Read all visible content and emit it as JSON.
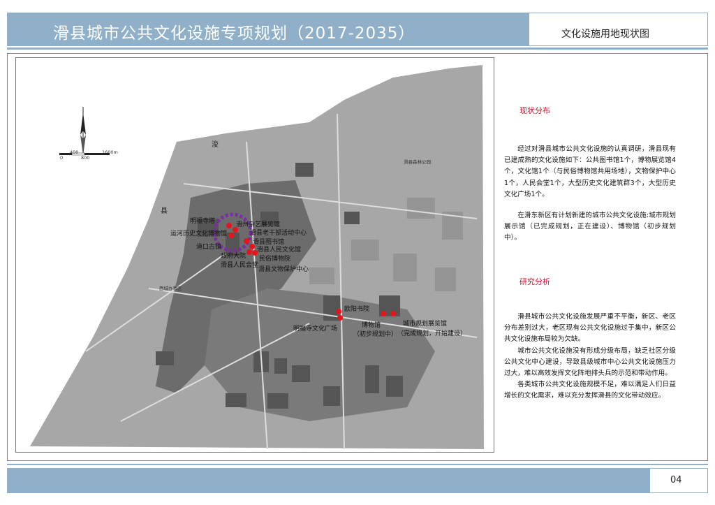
{
  "header": {
    "title": "滑县城市公共文化设施专项规划（2017-2035）",
    "subtitle": "文化设施用地现状图"
  },
  "footer": {
    "page_number": "04"
  },
  "sidebar": {
    "section1_title": "现状分布",
    "section1_paragraphs": [
      "经过对滑县城市公共文化设施的认真调研，滑县现有已建成熟的文化设施如下：公共图书馆1个，博物展览馆4个，文化馆1个（与民俗博物馆共用场地），文物保护中心1个，人民会堂1个，大型历史文化建筑群3个，大型历史文化广场1个。",
      "在滑东新区有计划新建的城市公共文化设施:城市规划展示馆（已完成规划，正在建设）、博物馆（初步规划中）。"
    ],
    "section2_title": "研究分析",
    "section2_paragraphs": [
      "滑县城市公共文化设施发展严重不平衡，新区、老区分布差别过大，老区现有公共文化设施过于集中，新区公共文化设施布局较为欠缺。",
      "城市公共文化设施没有形成分级布局，缺乏社区分级公共文化中心建设，导致县级城市中心公共文化设施压力过大，难以高效发挥文化阵地排头兵的示范和带动作用。",
      "各类城市公共文化设施规模不足，难以满足人们日益增长的文化需求，难以充分发挥滑县的文化带动效应。"
    ]
  },
  "map": {
    "scale_labels": [
      "0",
      "400",
      "800",
      "1600m"
    ],
    "region_labels": {
      "river1": "浚",
      "river2": "县",
      "forest": "滑县森林公园",
      "west": "西城办事区"
    },
    "facility_labels": [
      "明福寺塔",
      "滑州杂艺展览馆",
      "运河历史文化博物馆",
      "滑县老干部活动中心",
      "滑县图书馆",
      "道口古镇",
      "滑县人民文化馆",
      "政府大院",
      "民俗博物院",
      "滑县人民会堂",
      "滑县文物保护中心",
      "欧阳书院",
      "明福寺文化广场",
      "博物馆",
      "（初步规划中）",
      "城市规划展览馆",
      "（完成规划，开始建设）"
    ],
    "marker_color": "#e8141c",
    "buffer_color": "#7b2ea0"
  }
}
